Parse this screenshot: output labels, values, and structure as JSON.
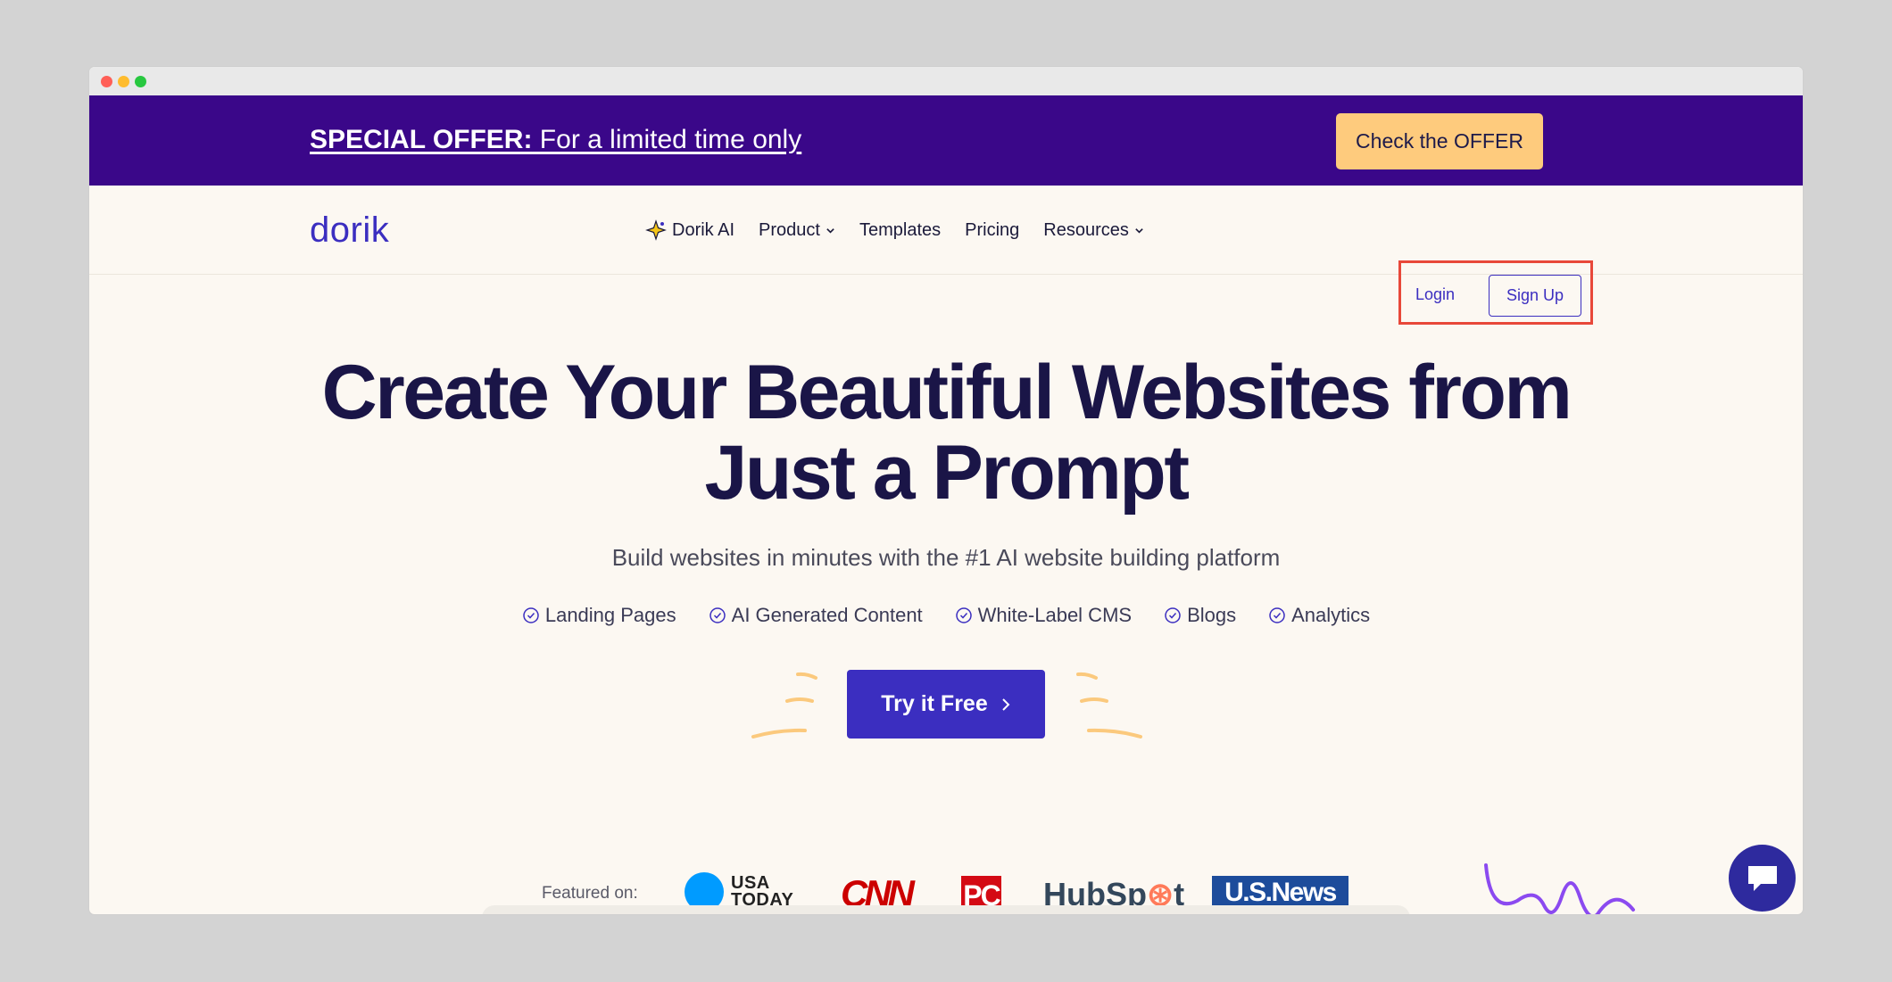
{
  "window": {
    "controls": [
      "close",
      "minimize",
      "maximize"
    ]
  },
  "offer": {
    "strong": "SPECIAL OFFER:",
    "text": " For a limited time only",
    "button": "Check the OFFER"
  },
  "nav": {
    "logo": "dorik",
    "items": [
      {
        "label": "Dorik AI",
        "icon": "sparkle-icon"
      },
      {
        "label": "Product",
        "icon": "chevron-down-icon"
      },
      {
        "label": "Templates"
      },
      {
        "label": "Pricing"
      },
      {
        "label": "Resources",
        "icon": "chevron-down-icon"
      }
    ],
    "login": "Login",
    "signup": "Sign Up"
  },
  "hero": {
    "title_line1": "Create Your Beautiful Websites from",
    "title_line2": "Just a Prompt",
    "subtitle": "Build websites in minutes with the #1 AI website building platform",
    "features": [
      "Landing Pages",
      "AI Generated Content",
      "White-Label CMS",
      "Blogs",
      "Analytics"
    ],
    "cta": "Try it Free"
  },
  "featured": {
    "label": "Featured on:",
    "logos": {
      "usa_today_1": "USA",
      "usa_today_2": "TODAY",
      "cnn": "CNN",
      "pc": "PC",
      "hubspot_a": "HubSp",
      "hubspot_b": "t",
      "usnews": "U.S.News"
    }
  },
  "colors": {
    "offer_bg": "#3a0789",
    "offer_button": "#fecb7d",
    "primary": "#3b2ec0",
    "heading": "#1a1547",
    "page_bg": "#fcf8f2",
    "highlight": "#e8483a"
  }
}
